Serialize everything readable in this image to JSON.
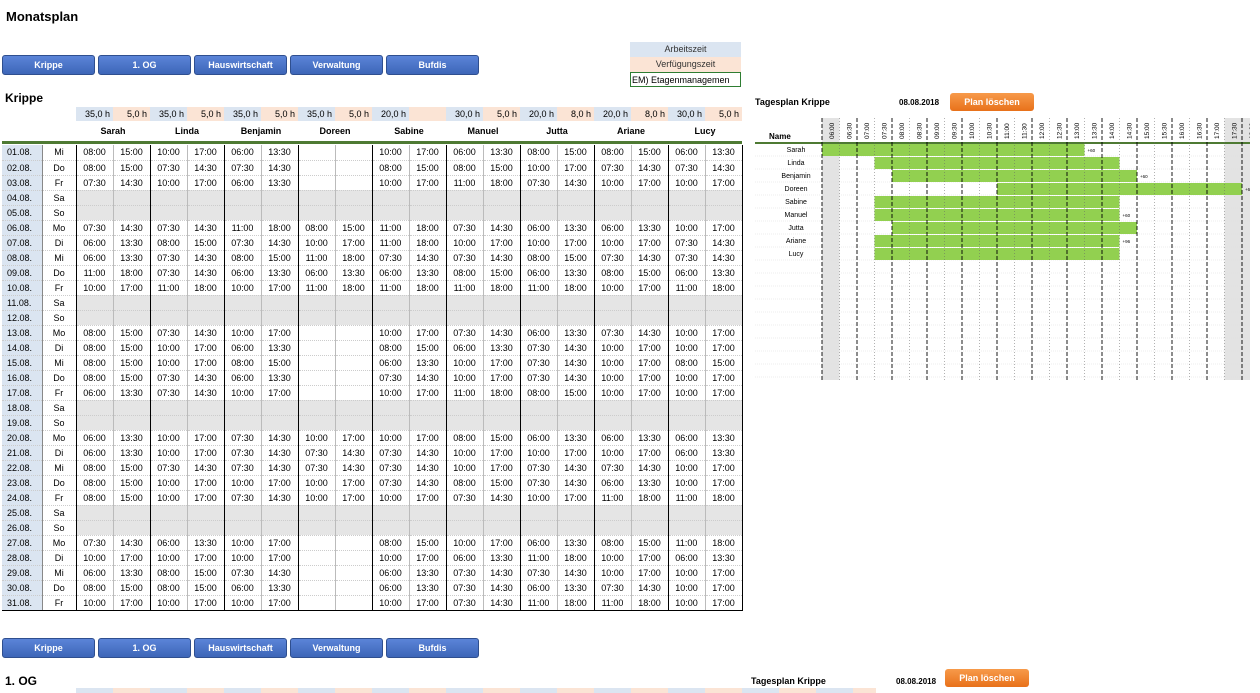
{
  "page_title": "Monatsplan",
  "nav": [
    "Krippe",
    "1. OG",
    "Hauswirtschaft",
    "Verwaltung",
    "Bufdis"
  ],
  "legend": {
    "work": "Arbeitszeit",
    "avail": "Verfügungszeit",
    "em": "EM) Etagenmanagemen"
  },
  "section1": {
    "title": "Krippe"
  },
  "section2": {
    "title": "1. OG"
  },
  "hours": [
    "35,0 h",
    "5,0 h",
    "35,0 h",
    "5,0 h",
    "35,0 h",
    "5,0 h",
    "35,0 h",
    "5,0 h",
    "20,0 h",
    "",
    "30,0 h",
    "5,0 h",
    "20,0 h",
    "8,0 h",
    "20,0 h",
    "8,0 h",
    "30,0 h",
    "5,0 h"
  ],
  "staff": [
    "Sarah",
    "Linda",
    "Benjamin",
    "Doreen",
    "Sabine",
    "Manuel",
    "Jutta",
    "Ariane",
    "Lucy"
  ],
  "rows": [
    [
      "01.08.",
      "Mi",
      [
        "08:00",
        "15:00",
        "10:00",
        "17:00",
        "06:00",
        "13:30",
        "",
        "",
        "10:00",
        "17:00",
        "06:00",
        "13:30",
        "08:00",
        "15:00",
        "08:00",
        "15:00",
        "06:00",
        "13:30"
      ]
    ],
    [
      "02.08.",
      "Do",
      [
        "08:00",
        "15:00",
        "07:30",
        "14:30",
        "07:30",
        "14:30",
        "",
        "",
        "08:00",
        "15:00",
        "08:00",
        "15:00",
        "10:00",
        "17:00",
        "07:30",
        "14:30",
        "07:30",
        "14:30"
      ]
    ],
    [
      "03.08.",
      "Fr",
      [
        "07:30",
        "14:30",
        "10:00",
        "17:00",
        "06:00",
        "13:30",
        "",
        "",
        "10:00",
        "17:00",
        "11:00",
        "18:00",
        "07:30",
        "14:30",
        "10:00",
        "17:00",
        "10:00",
        "17:00"
      ]
    ],
    [
      "04.08.",
      "Sa",
      null
    ],
    [
      "05.08.",
      "So",
      null
    ],
    [
      "06.08.",
      "Mo",
      [
        "07:30",
        "14:30",
        "07:30",
        "14:30",
        "11:00",
        "18:00",
        "08:00",
        "15:00",
        "11:00",
        "18:00",
        "07:30",
        "14:30",
        "06:00",
        "13:30",
        "06:00",
        "13:30",
        "10:00",
        "17:00"
      ]
    ],
    [
      "07.08.",
      "Di",
      [
        "06:00",
        "13:30",
        "08:00",
        "15:00",
        "07:30",
        "14:30",
        "10:00",
        "17:00",
        "11:00",
        "18:00",
        "10:00",
        "17:00",
        "10:00",
        "17:00",
        "10:00",
        "17:00",
        "07:30",
        "14:30"
      ]
    ],
    [
      "08.08.",
      "Mi",
      [
        "06:00",
        "13:30",
        "07:30",
        "14:30",
        "08:00",
        "15:00",
        "11:00",
        "18:00",
        "07:30",
        "14:30",
        "07:30",
        "14:30",
        "08:00",
        "15:00",
        "07:30",
        "14:30",
        "07:30",
        "14:30"
      ]
    ],
    [
      "09.08.",
      "Do",
      [
        "11:00",
        "18:00",
        "07:30",
        "14:30",
        "06:00",
        "13:30",
        "06:00",
        "13:30",
        "06:00",
        "13:30",
        "08:00",
        "15:00",
        "06:00",
        "13:30",
        "08:00",
        "15:00",
        "06:00",
        "13:30"
      ]
    ],
    [
      "10.08.",
      "Fr",
      [
        "10:00",
        "17:00",
        "11:00",
        "18:00",
        "10:00",
        "17:00",
        "11:00",
        "18:00",
        "11:00",
        "18:00",
        "11:00",
        "18:00",
        "11:00",
        "18:00",
        "10:00",
        "17:00",
        "11:00",
        "18:00"
      ]
    ],
    [
      "11.08.",
      "Sa",
      null
    ],
    [
      "12.08.",
      "So",
      null
    ],
    [
      "13.08.",
      "Mo",
      [
        "08:00",
        "15:00",
        "07:30",
        "14:30",
        "10:00",
        "17:00",
        "",
        "",
        "10:00",
        "17:00",
        "07:30",
        "14:30",
        "06:00",
        "13:30",
        "07:30",
        "14:30",
        "10:00",
        "17:00"
      ]
    ],
    [
      "14.08.",
      "Di",
      [
        "08:00",
        "15:00",
        "10:00",
        "17:00",
        "06:00",
        "13:30",
        "",
        "",
        "08:00",
        "15:00",
        "06:00",
        "13:30",
        "07:30",
        "14:30",
        "10:00",
        "17:00",
        "10:00",
        "17:00"
      ]
    ],
    [
      "15.08.",
      "Mi",
      [
        "08:00",
        "15:00",
        "10:00",
        "17:00",
        "08:00",
        "15:00",
        "",
        "",
        "06:00",
        "13:30",
        "10:00",
        "17:00",
        "07:30",
        "14:30",
        "10:00",
        "17:00",
        "08:00",
        "15:00"
      ]
    ],
    [
      "16.08.",
      "Do",
      [
        "08:00",
        "15:00",
        "07:30",
        "14:30",
        "06:00",
        "13:30",
        "",
        "",
        "07:30",
        "14:30",
        "10:00",
        "17:00",
        "07:30",
        "14:30",
        "10:00",
        "17:00",
        "10:00",
        "17:00"
      ]
    ],
    [
      "17.08.",
      "Fr",
      [
        "06:00",
        "13:30",
        "07:30",
        "14:30",
        "10:00",
        "17:00",
        "",
        "",
        "10:00",
        "17:00",
        "11:00",
        "18:00",
        "08:00",
        "15:00",
        "10:00",
        "17:00",
        "10:00",
        "17:00"
      ]
    ],
    [
      "18.08.",
      "Sa",
      null
    ],
    [
      "19.08.",
      "So",
      null
    ],
    [
      "20.08.",
      "Mo",
      [
        "06:00",
        "13:30",
        "10:00",
        "17:00",
        "07:30",
        "14:30",
        "10:00",
        "17:00",
        "10:00",
        "17:00",
        "08:00",
        "15:00",
        "06:00",
        "13:30",
        "06:00",
        "13:30",
        "06:00",
        "13:30"
      ]
    ],
    [
      "21.08.",
      "Di",
      [
        "06:00",
        "13:30",
        "10:00",
        "17:00",
        "07:30",
        "14:30",
        "07:30",
        "14:30",
        "07:30",
        "14:30",
        "10:00",
        "17:00",
        "10:00",
        "17:00",
        "10:00",
        "17:00",
        "06:00",
        "13:30"
      ]
    ],
    [
      "22.08.",
      "Mi",
      [
        "08:00",
        "15:00",
        "07:30",
        "14:30",
        "07:30",
        "14:30",
        "07:30",
        "14:30",
        "07:30",
        "14:30",
        "10:00",
        "17:00",
        "07:30",
        "14:30",
        "07:30",
        "14:30",
        "10:00",
        "17:00"
      ]
    ],
    [
      "23.08.",
      "Do",
      [
        "08:00",
        "15:00",
        "10:00",
        "17:00",
        "10:00",
        "17:00",
        "10:00",
        "17:00",
        "07:30",
        "14:30",
        "08:00",
        "15:00",
        "07:30",
        "14:30",
        "06:00",
        "13:30",
        "10:00",
        "17:00"
      ]
    ],
    [
      "24.08.",
      "Fr",
      [
        "08:00",
        "15:00",
        "10:00",
        "17:00",
        "07:30",
        "14:30",
        "10:00",
        "17:00",
        "10:00",
        "17:00",
        "07:30",
        "14:30",
        "10:00",
        "17:00",
        "11:00",
        "18:00",
        "11:00",
        "18:00"
      ]
    ],
    [
      "25.08.",
      "Sa",
      null
    ],
    [
      "26.08.",
      "So",
      null
    ],
    [
      "27.08.",
      "Mo",
      [
        "07:30",
        "14:30",
        "06:00",
        "13:30",
        "10:00",
        "17:00",
        "",
        "",
        "08:00",
        "15:00",
        "10:00",
        "17:00",
        "06:00",
        "13:30",
        "08:00",
        "15:00",
        "11:00",
        "18:00"
      ]
    ],
    [
      "28.08.",
      "Di",
      [
        "10:00",
        "17:00",
        "10:00",
        "17:00",
        "10:00",
        "17:00",
        "",
        "",
        "10:00",
        "17:00",
        "06:00",
        "13:30",
        "11:00",
        "18:00",
        "10:00",
        "17:00",
        "06:00",
        "13:30"
      ]
    ],
    [
      "29.08.",
      "Mi",
      [
        "06:00",
        "13:30",
        "08:00",
        "15:00",
        "07:30",
        "14:30",
        "",
        "",
        "06:00",
        "13:30",
        "07:30",
        "14:30",
        "07:30",
        "14:30",
        "10:00",
        "17:00",
        "10:00",
        "17:00"
      ]
    ],
    [
      "30.08.",
      "Do",
      [
        "08:00",
        "15:00",
        "08:00",
        "15:00",
        "06:00",
        "13:30",
        "",
        "",
        "06:00",
        "13:30",
        "07:30",
        "14:30",
        "06:00",
        "13:30",
        "07:30",
        "14:30",
        "10:00",
        "17:00"
      ]
    ],
    [
      "31.08.",
      "Fr",
      [
        "10:00",
        "17:00",
        "10:00",
        "17:00",
        "10:00",
        "17:00",
        "",
        "",
        "10:00",
        "17:00",
        "07:30",
        "14:30",
        "11:00",
        "18:00",
        "11:00",
        "18:00",
        "10:00",
        "17:00"
      ]
    ]
  ],
  "tagesplan": {
    "label": "Tagesplan Krippe",
    "date": "08.08.2018",
    "button": "Plan löschen",
    "name_header": "Name",
    "times": [
      "06:00",
      "06:30",
      "07:00",
      "07:30",
      "08:00",
      "08:30",
      "09:00",
      "09:30",
      "10:00",
      "10:30",
      "11:00",
      "11:30",
      "12:00",
      "12:30",
      "13:00",
      "13:30",
      "14:00",
      "14:30",
      "15:00",
      "15:30",
      "16:00",
      "16:30",
      "17:00",
      "17:30",
      "18:00"
    ],
    "people": [
      {
        "name": "Sarah",
        "start": "06:00",
        "end": "13:30",
        "note": "+60"
      },
      {
        "name": "Linda",
        "start": "07:30",
        "end": "14:30",
        "note": ""
      },
      {
        "name": "Benjamin",
        "start": "08:00",
        "end": "15:00",
        "note": "+60"
      },
      {
        "name": "Doreen",
        "start": "11:00",
        "end": "18:00",
        "note": "+60"
      },
      {
        "name": "Sabine",
        "start": "07:30",
        "end": "14:30",
        "note": ""
      },
      {
        "name": "Manuel",
        "start": "07:30",
        "end": "14:30",
        "note": "+60"
      },
      {
        "name": "Jutta",
        "start": "08:00",
        "end": "15:00",
        "note": ""
      },
      {
        "name": "Ariane",
        "start": "07:30",
        "end": "14:30",
        "note": "+96"
      },
      {
        "name": "Lucy",
        "start": "07:30",
        "end": "14:30",
        "note": ""
      }
    ]
  }
}
